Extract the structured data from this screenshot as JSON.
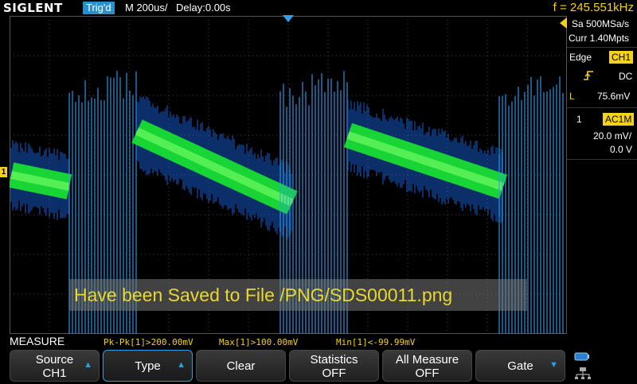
{
  "header": {
    "logo": "SIGLENT",
    "trigger_status": "Trig'd",
    "timebase": "M 200us/",
    "delay": "Delay:0.00s",
    "frequency": "f = 245.551kHz"
  },
  "screen": {
    "message": "Have been Saved to File /PNG/SDS00011.png",
    "channel_marker": "1"
  },
  "side_panel": {
    "sample_rate": "Sa 500MSa/s",
    "memory": "Curr 1.40Mpts",
    "trigger_type": "Edge",
    "trigger_source": "CH1",
    "trigger_coupling": "DC",
    "trigger_level_label": "L",
    "trigger_level": "75.6mV",
    "channel_number": "1",
    "channel_coupling": "AC1M",
    "volts_per_div": "20.0 mV/",
    "offset": "0.0 V"
  },
  "measure": {
    "label": "MEASURE",
    "values": [
      "Pk-Pk[1]>200.00mV",
      "Max[1]>100.00mV",
      "Min[1]<-99.99mV"
    ]
  },
  "menu": {
    "source_label": "Source",
    "source_value": "CH1",
    "type_label": "Type",
    "clear_label": "Clear",
    "statistics_label": "Statistics",
    "statistics_value": "OFF",
    "all_measure_label": "All Measure",
    "all_measure_value": "OFF",
    "gate_label": "Gate"
  },
  "colors": {
    "accent_blue": "#2aa0e0",
    "trace_yellow": "#f5d21a",
    "trace_green": "#19e830",
    "trace_blue": "#1a6cf0"
  }
}
